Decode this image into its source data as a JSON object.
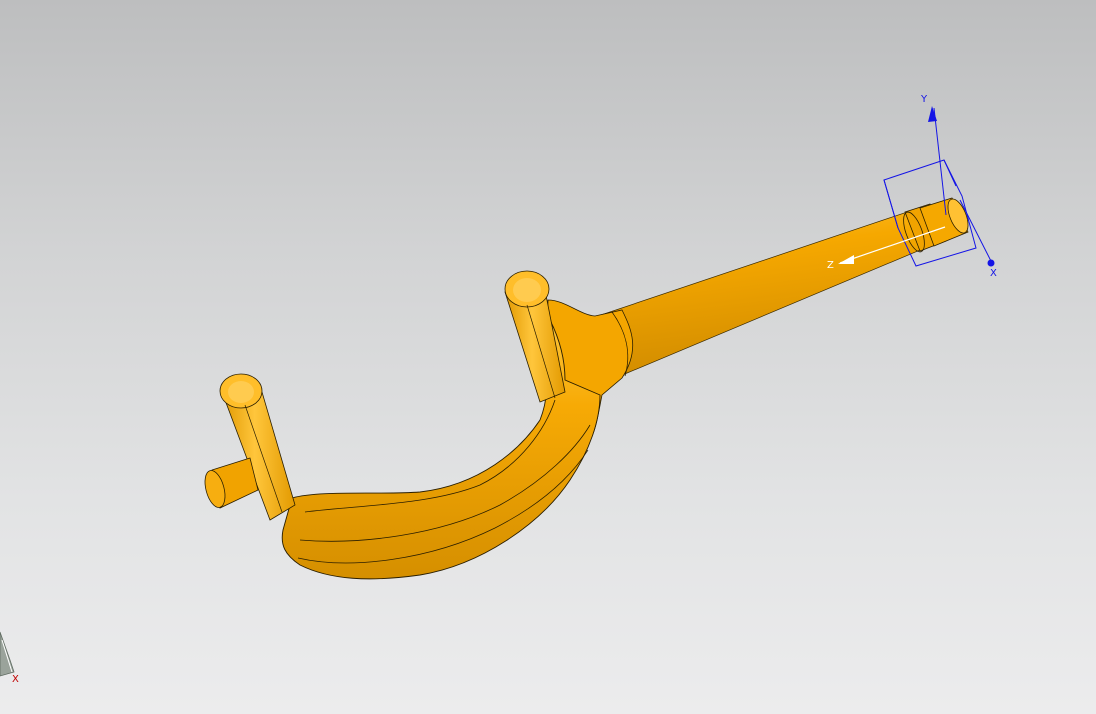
{
  "viewport": {
    "background_top": "#bdbebf",
    "background_bottom": "#ececed",
    "model_color": "#f6a800",
    "model_shadow": "#c98500",
    "model_highlight": "#ffce45",
    "edge_color": "#2a1e00"
  },
  "csys": {
    "color": "#1414e6",
    "y_label": "Y",
    "x_label": "X",
    "z_label": "Z"
  },
  "triad": {
    "x_label": "X",
    "color": "#c00000"
  }
}
